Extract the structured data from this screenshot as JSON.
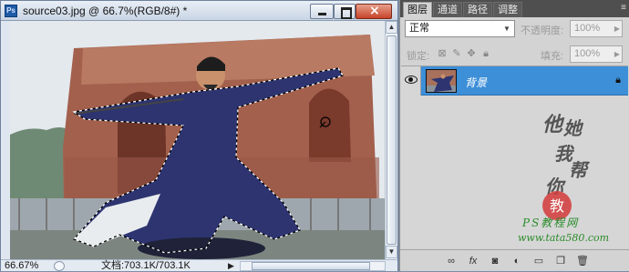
{
  "document": {
    "app_icon_label": "Ps",
    "title": "source03.jpg @ 66.7%(RGB/8#) *",
    "status": {
      "zoom": "66.67%",
      "doc_info": "文档:703.1K/703.1K"
    }
  },
  "layers_panel": {
    "tabs": [
      {
        "label": "图层",
        "active": true
      },
      {
        "label": "通道",
        "active": false
      },
      {
        "label": "路径",
        "active": false
      },
      {
        "label": "调整",
        "active": false
      }
    ],
    "blend_mode": "正常",
    "opacity_label": "不透明度:",
    "opacity_value": "100%",
    "lock_label": "锁定:",
    "fill_label": "填充:",
    "fill_value": "100%",
    "layers": [
      {
        "name": "背景",
        "visible": true,
        "locked": true,
        "selected": true
      }
    ],
    "watermark": {
      "chars": [
        "他",
        "她",
        "我",
        "帮",
        "你"
      ],
      "seal_text": "教",
      "site_name": "PS教程网",
      "site_url": "www.tata580.com"
    }
  },
  "colors": {
    "selected_layer": "#3d8fd8",
    "panel_bg": "#d3d3d3",
    "title_bar": "#c9d5e4"
  }
}
